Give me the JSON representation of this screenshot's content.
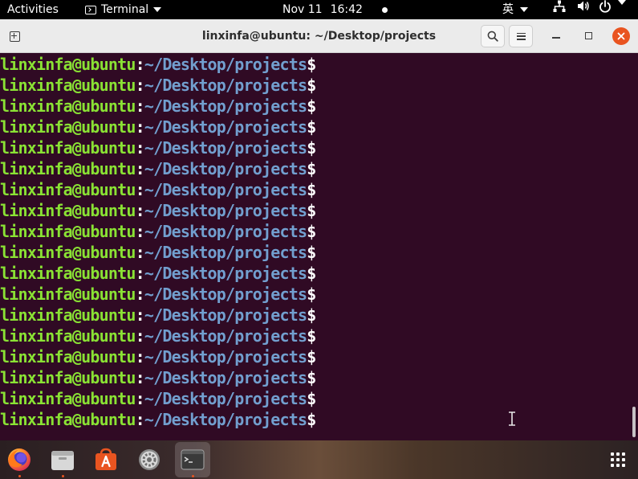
{
  "top_bar": {
    "activities": "Activities",
    "app_menu_label": "Terminal",
    "date": "Nov 11",
    "time": "16:42",
    "input_method": "英",
    "icons": [
      "terminal-icon",
      "network-icon",
      "volume-icon",
      "power-icon",
      "chevron-down-icon"
    ]
  },
  "window": {
    "title": "linxinfa@ubuntu: ~/Desktop/projects",
    "buttons": [
      "new-tab",
      "search",
      "menu",
      "minimize",
      "maximize",
      "close"
    ],
    "accent_color": "#e95420"
  },
  "terminal": {
    "background": "#300a24",
    "user_color": "#8ae234",
    "path_color": "#729fcf",
    "prompts": [
      {
        "user": "linxinfa@ubuntu",
        "path": "~/Desktop/projects",
        "symbol": "$"
      },
      {
        "user": "linxinfa@ubuntu",
        "path": "~/Desktop/projects",
        "symbol": "$"
      },
      {
        "user": "linxinfa@ubuntu",
        "path": "~/Desktop/projects",
        "symbol": "$"
      },
      {
        "user": "linxinfa@ubuntu",
        "path": "~/Desktop/projects",
        "symbol": "$"
      },
      {
        "user": "linxinfa@ubuntu",
        "path": "~/Desktop/projects",
        "symbol": "$"
      },
      {
        "user": "linxinfa@ubuntu",
        "path": "~/Desktop/projects",
        "symbol": "$"
      },
      {
        "user": "linxinfa@ubuntu",
        "path": "~/Desktop/projects",
        "symbol": "$"
      },
      {
        "user": "linxinfa@ubuntu",
        "path": "~/Desktop/projects",
        "symbol": "$"
      },
      {
        "user": "linxinfa@ubuntu",
        "path": "~/Desktop/projects",
        "symbol": "$"
      },
      {
        "user": "linxinfa@ubuntu",
        "path": "~/Desktop/projects",
        "symbol": "$"
      },
      {
        "user": "linxinfa@ubuntu",
        "path": "~/Desktop/projects",
        "symbol": "$"
      },
      {
        "user": "linxinfa@ubuntu",
        "path": "~/Desktop/projects",
        "symbol": "$"
      },
      {
        "user": "linxinfa@ubuntu",
        "path": "~/Desktop/projects",
        "symbol": "$"
      },
      {
        "user": "linxinfa@ubuntu",
        "path": "~/Desktop/projects",
        "symbol": "$"
      },
      {
        "user": "linxinfa@ubuntu",
        "path": "~/Desktop/projects",
        "symbol": "$"
      },
      {
        "user": "linxinfa@ubuntu",
        "path": "~/Desktop/projects",
        "symbol": "$"
      },
      {
        "user": "linxinfa@ubuntu",
        "path": "~/Desktop/projects",
        "symbol": "$"
      },
      {
        "user": "linxinfa@ubuntu",
        "path": "~/Desktop/projects",
        "symbol": "$"
      }
    ]
  },
  "dock": {
    "apps": [
      {
        "icon": "firefox-icon",
        "running": true,
        "active": false
      },
      {
        "icon": "files-icon",
        "running": true,
        "active": false
      },
      {
        "icon": "software-icon",
        "running": false,
        "active": false
      },
      {
        "icon": "settings-icon",
        "running": false,
        "active": false
      },
      {
        "icon": "terminal-icon",
        "running": true,
        "active": true
      }
    ],
    "show_apps_icon": "show-applications-icon"
  }
}
